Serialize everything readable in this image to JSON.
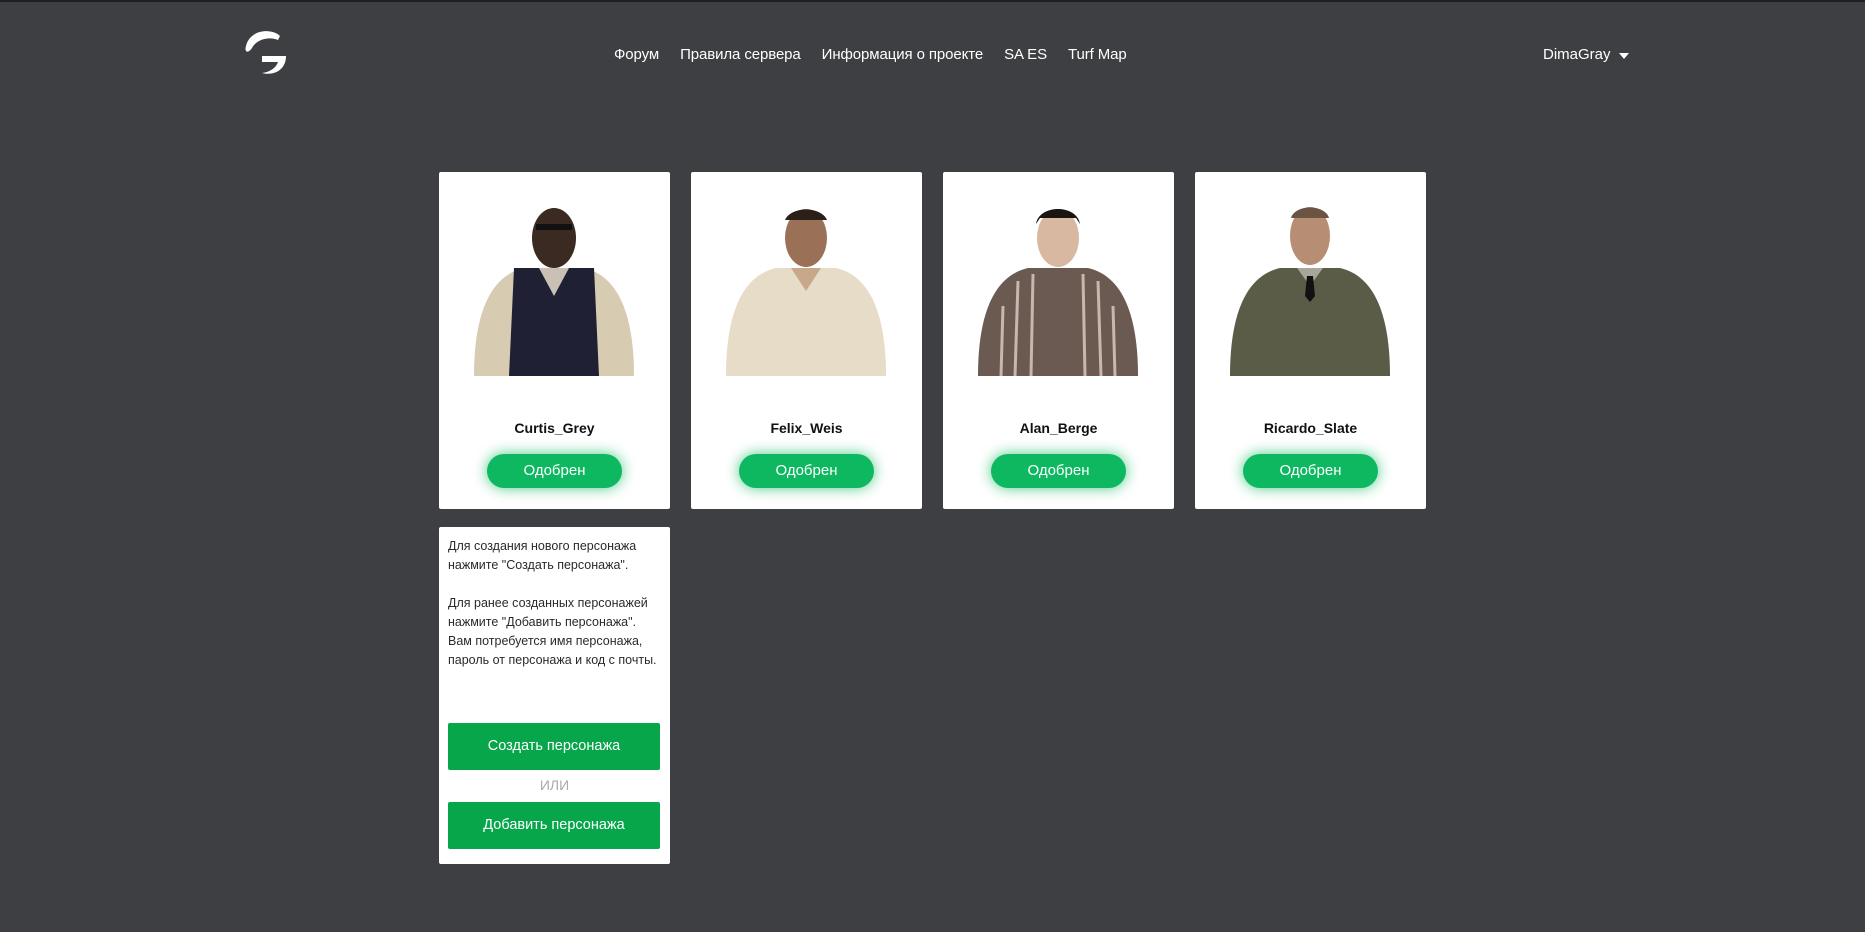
{
  "header": {
    "logo_icon": "g-logo-icon",
    "nav": [
      "Форум",
      "Правила сервера",
      "Информация о проекте",
      "SA ES",
      "Turf Map"
    ],
    "user_name": "DimaGray",
    "user_menu_icon": "caret-down-icon"
  },
  "characters": [
    {
      "name": "Curtis_Grey",
      "status": "Одобрен"
    },
    {
      "name": "Felix_Weis",
      "status": "Одобрен"
    },
    {
      "name": "Alan_Berge",
      "status": "Одобрен"
    },
    {
      "name": "Ricardo_Slate",
      "status": "Одобрен"
    }
  ],
  "info": {
    "paragraph1": "Для создания нового персонажа нажмите \"Создать персонажа\".",
    "paragraph2": "Для ранее созданных персонажей нажмите \"Добавить персонажа\". Вам потребуется имя персонажа, пароль от персонажа и код с почты.",
    "create_label": "Создать персонажа",
    "or_label": "ИЛИ",
    "add_label": "Добавить персонажа"
  },
  "colors": {
    "background": "#3e3f42",
    "accent_green": "#0db860",
    "button_green": "#07a64b"
  }
}
